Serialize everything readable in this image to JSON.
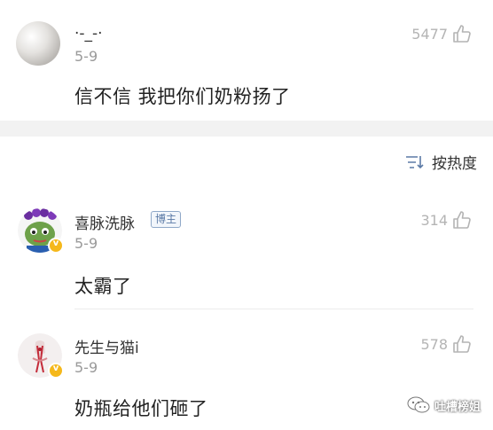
{
  "comments": [
    {
      "user": "·-_-·",
      "date": "5-9",
      "text": "信不信 我把你们奶粉扬了",
      "likes": "5477"
    },
    {
      "user": "喜脉洗脉",
      "tag": "博主",
      "date": "5-9",
      "text": "太霸了",
      "likes": "314"
    },
    {
      "user": "先生与猫i",
      "date": "5-9",
      "text": "奶瓶给他们砸了",
      "likes": "578"
    }
  ],
  "sort": {
    "label": "按热度"
  },
  "watermark": {
    "text": "吐槽榜姐"
  },
  "icons": {
    "like": "thumbs-up-icon",
    "sort": "sort-icon",
    "verified": "verified-v-icon",
    "wechat": "wechat-icon"
  },
  "colors": {
    "like_gray": "#b4b4b4",
    "verified_gold": "#f5b81b",
    "tag_blue": "#5b7aa6",
    "separator": "#f2f2f2"
  }
}
